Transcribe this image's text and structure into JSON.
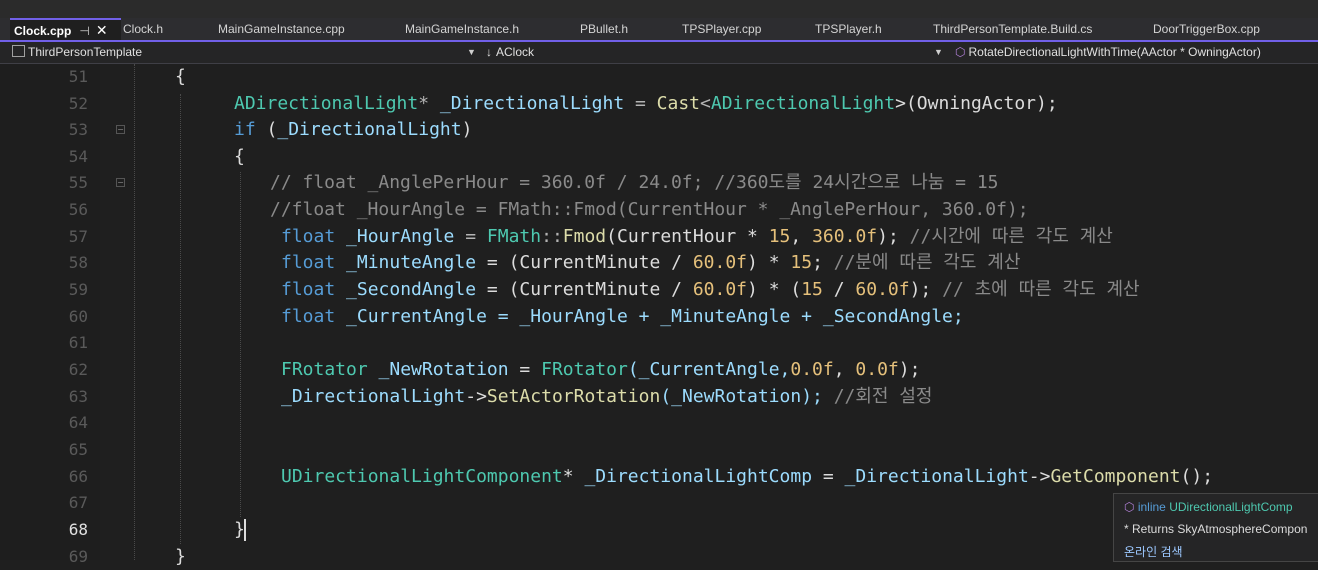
{
  "tabs": [
    {
      "label": "Clock.cpp",
      "active": true
    },
    {
      "label": "Clock.h"
    },
    {
      "label": "MainGameInstance.cpp"
    },
    {
      "label": "MainGameInstance.h"
    },
    {
      "label": "PBullet.h"
    },
    {
      "label": "TPSPlayer.cpp"
    },
    {
      "label": "TPSPlayer.h"
    },
    {
      "label": "ThirdPersonTemplate.Build.cs"
    },
    {
      "label": "DoorTriggerBox.cpp"
    }
  ],
  "nav": {
    "project": "ThirdPersonTemplate",
    "scope": "AClock",
    "member": "RotateDirectionalLightWithTime(AActor * OwningActor)"
  },
  "line_numbers": [
    "51",
    "52",
    "53",
    "54",
    "55",
    "56",
    "57",
    "58",
    "59",
    "60",
    "61",
    "62",
    "63",
    "64",
    "65",
    "66",
    "67",
    "68",
    "69"
  ],
  "code": {
    "l51": "{",
    "l52": [
      "ADirectionalLight",
      "* ",
      "_DirectionalLight",
      " = ",
      "Cast",
      "<",
      "ADirectionalLight",
      ">(OwningActor);"
    ],
    "l53": [
      "if",
      " (",
      "_DirectionalLight",
      ")"
    ],
    "l54": "{",
    "l55": "// float _AnglePerHour = 360.0f / 24.0f; //360도를 24시간으로 나눔 = 15",
    "l56": "//float _HourAngle = FMath::Fmod(CurrentHour * _AnglePerHour, 360.0f);",
    "l57": [
      "float",
      " _HourAngle",
      " = ",
      "FMath",
      "::",
      "Fmod",
      "(CurrentHour * ",
      "15",
      ", ",
      "360.0f",
      "); ",
      "//시간에 따른 각도 계산"
    ],
    "l58": [
      "float",
      " _MinuteAngle",
      " = (CurrentMinute / ",
      "60.0f",
      ") * ",
      "15",
      "; ",
      "//분에 따른 각도 계산"
    ],
    "l59": [
      "float",
      " _SecondAngle",
      " = (CurrentMinute / ",
      "60.0f",
      ") * (",
      "15",
      " / ",
      "60.0f",
      "); ",
      "// 초에 따른 각도 계산"
    ],
    "l60": [
      "float",
      " _CurrentAngle",
      " = _HourAngle + _MinuteAngle + _SecondAngle;"
    ],
    "l62": [
      "FRotator",
      " _NewRotation",
      " = ",
      "FRotator",
      "(_CurrentAngle,",
      "0.0f",
      ", ",
      "0.0f",
      ");"
    ],
    "l63": [
      "_DirectionalLight",
      "->",
      "SetActorRotation",
      "(_NewRotation); ",
      "//회전 설정"
    ],
    "l66": [
      "UDirectionalLightComponent",
      "* ",
      "_DirectionalLightComp",
      " = ",
      "_DirectionalLight",
      "->",
      "GetComponent",
      "();"
    ],
    "l68": "}",
    "l69": "}"
  },
  "tooltip": {
    "line1_kw": "inline",
    "line1_type": "UDirectionalLightComp",
    "line2": "* Returns SkyAtmosphereCompon",
    "line3": "온라인 검색"
  },
  "colors": {
    "accent": "#7160e8",
    "background": "#1e1e1e"
  }
}
